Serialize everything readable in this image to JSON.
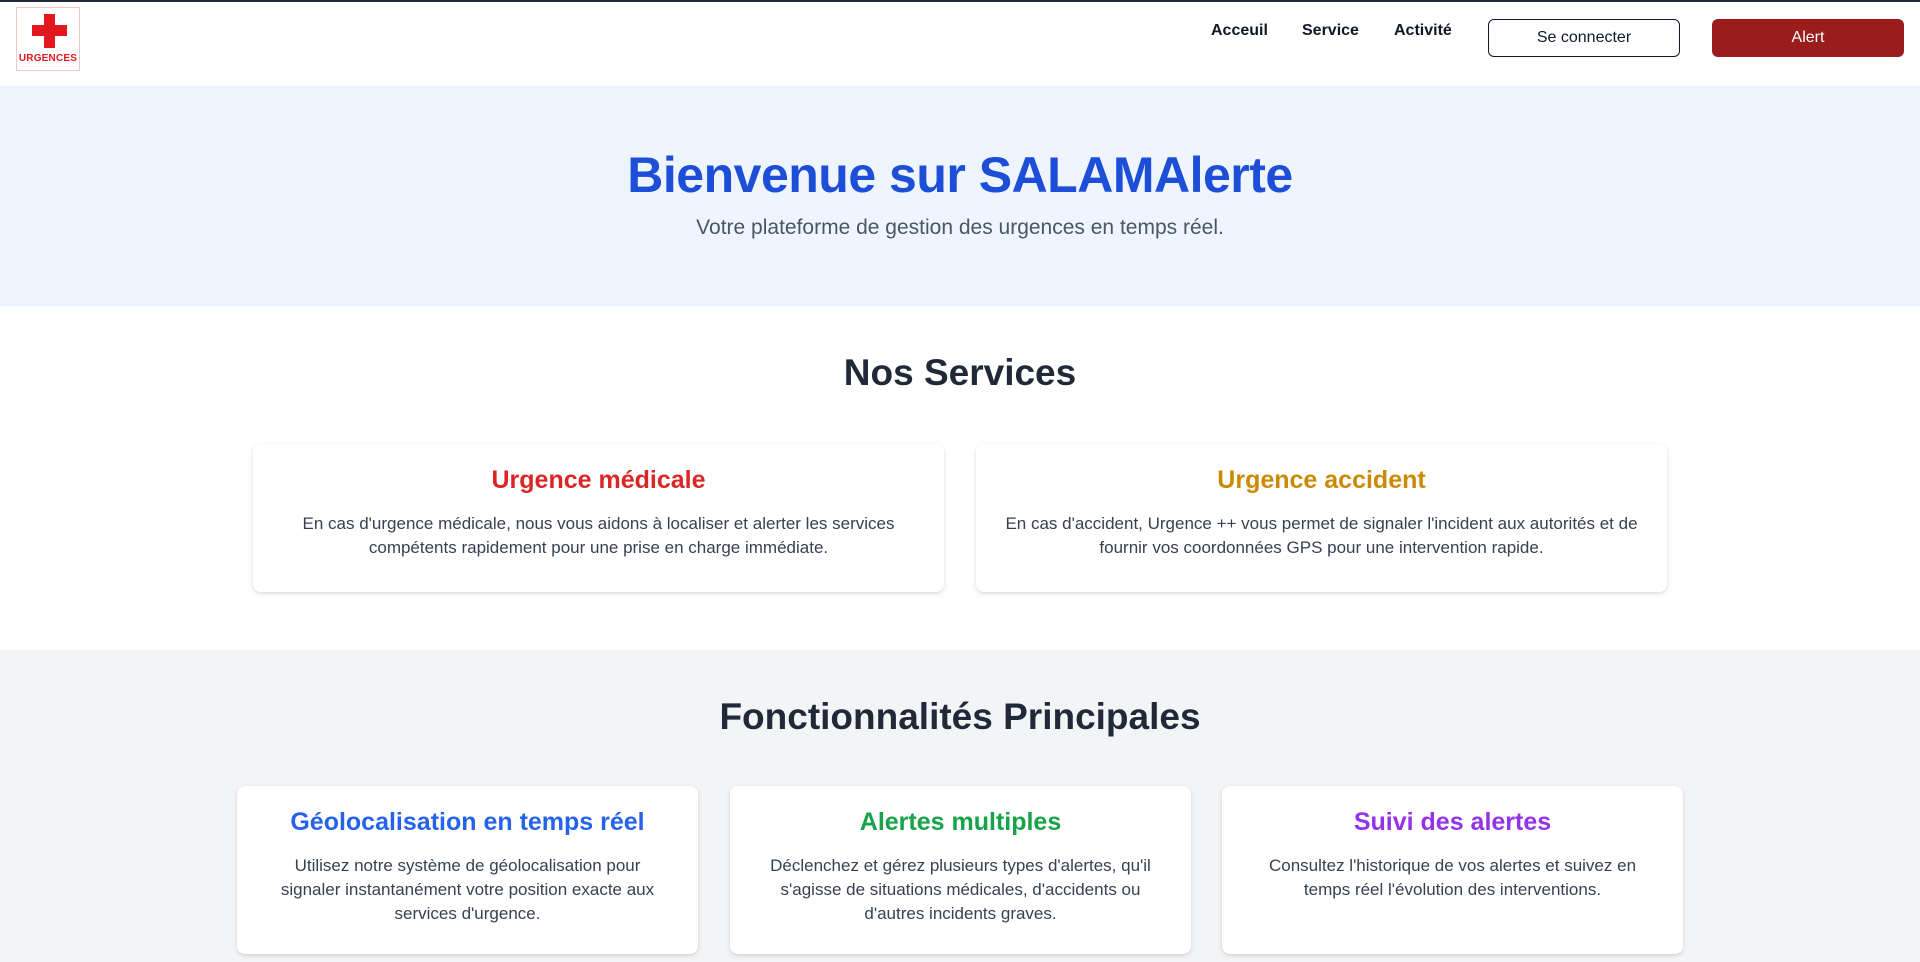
{
  "header": {
    "logo_text": "URGENCES",
    "nav": {
      "accueil": "Acceuil",
      "service": "Service",
      "activite": "Activité"
    },
    "login_label": "Se connecter",
    "alert_label": "Alert"
  },
  "hero": {
    "title": "Bienvenue sur SALAMAlerte",
    "subtitle": "Votre plateforme de gestion des urgences en temps réel."
  },
  "services": {
    "title": "Nos Services",
    "cards": [
      {
        "title": "Urgence médicale",
        "text": "En cas d'urgence médicale, nous vous aidons à localiser et alerter les services compétents rapidement pour une prise en charge immédiate.",
        "color": "#dc2626"
      },
      {
        "title": "Urgence accident",
        "text": "En cas d'accident, Urgence ++ vous permet de signaler l'incident aux autorités et de fournir vos coordonnées GPS pour une intervention rapide.",
        "color": "#ca8a04"
      }
    ]
  },
  "features": {
    "title": "Fonctionnalités Principales",
    "cards": [
      {
        "title": "Géolocalisation en temps réel",
        "text": "Utilisez notre système de géolocalisation pour signaler instantanément votre position exacte aux services d'urgence.",
        "color": "#2563eb"
      },
      {
        "title": "Alertes multiples",
        "text": "Déclenchez et gérez plusieurs types d'alertes, qu'il s'agisse de situations médicales, d'accidents ou d'autres incidents graves.",
        "color": "#16a34a"
      },
      {
        "title": "Suivi des alertes",
        "text": "Consultez l'historique de vos alertes et suivez en temps réel l'évolution des interventions.",
        "color": "#9333ea"
      }
    ]
  },
  "colors": {
    "brand_red": "#9b1c1c",
    "hero_title": "#1d4ed8",
    "hero_bg": "#eef5fe",
    "features_bg": "#f3f4f6"
  }
}
